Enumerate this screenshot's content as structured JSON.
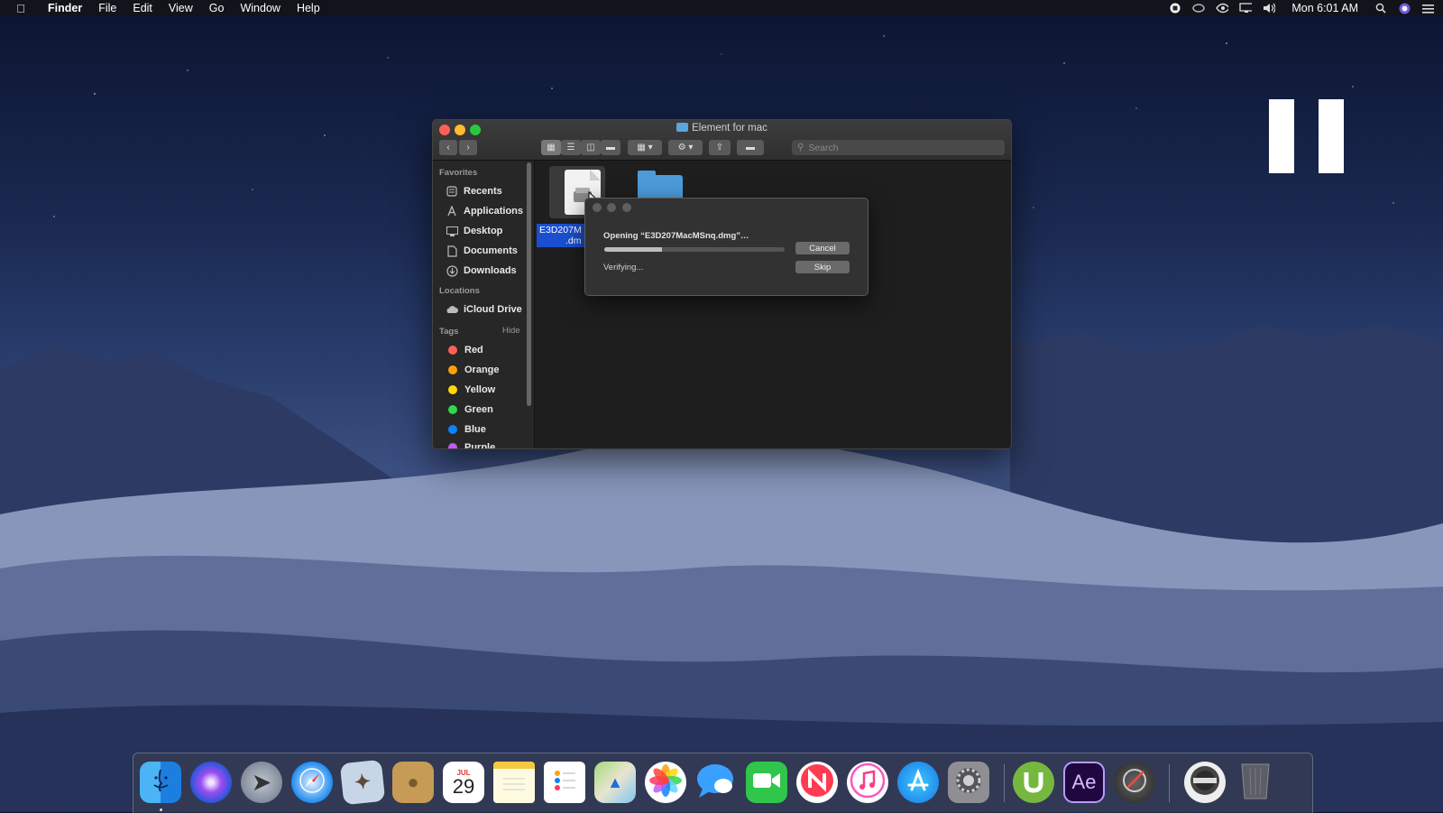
{
  "menubar": {
    "apple_icon": "apple-logo-icon",
    "items": [
      "Finder",
      "File",
      "Edit",
      "View",
      "Go",
      "Window",
      "Help"
    ],
    "clock": "Mon 6:01 AM",
    "status_icons": [
      "record-icon",
      "creative-cloud-icon",
      "nvidia-icon",
      "display-icon",
      "volume-icon",
      "search-icon",
      "siri-icon",
      "notification-center-icon"
    ]
  },
  "window": {
    "title": "Element for mac",
    "search_placeholder": "Search",
    "sidebar": {
      "favorites_label": "Favorites",
      "favorites": [
        {
          "label": "Recents",
          "icon": "clock-icon"
        },
        {
          "label": "Applications",
          "icon": "applications-icon"
        },
        {
          "label": "Desktop",
          "icon": "desktop-icon"
        },
        {
          "label": "Documents",
          "icon": "document-icon"
        },
        {
          "label": "Downloads",
          "icon": "download-icon"
        }
      ],
      "locations_label": "Locations",
      "locations": [
        {
          "label": "iCloud Drive",
          "icon": "cloud-icon"
        }
      ],
      "tags_label": "Tags",
      "tags_hide": "Hide",
      "tags": [
        {
          "label": "Red",
          "color": "#ff5f57"
        },
        {
          "label": "Orange",
          "color": "#ff9f0a"
        },
        {
          "label": "Yellow",
          "color": "#ffd60a"
        },
        {
          "label": "Green",
          "color": "#32d74b"
        },
        {
          "label": "Blue",
          "color": "#0a84ff"
        },
        {
          "label": "Purple",
          "color": "#bf5af2"
        }
      ]
    },
    "files": [
      {
        "label_line1": "E3D207M",
        "label_line2": ".dm",
        "icon": "dmg-disk-image-icon"
      },
      {
        "label": "",
        "icon": "folder-icon"
      }
    ]
  },
  "dialog": {
    "title": "Opening “E3D207MacMSnq.dmg”…",
    "status": "Verifying...",
    "progress": 0.32,
    "cancel_label": "Cancel",
    "skip_label": "Skip"
  },
  "dock": {
    "calendar_month": "JUL",
    "calendar_day": "29",
    "ae_label": "Ae",
    "apps": [
      "finder",
      "siri",
      "launchpad",
      "safari",
      "mail",
      "contacts",
      "calendar",
      "notes",
      "reminders",
      "maps",
      "photos",
      "messages",
      "facetime",
      "news",
      "itunes",
      "app-store",
      "system-preferences",
      "utorrent",
      "after-effects",
      "disk-utility",
      "webroot",
      "trash"
    ]
  },
  "colors": {
    "accent": "#1a4fd0",
    "folder": "#4d9bd8",
    "close": "#ff5f57",
    "minimize": "#febc2e",
    "zoom": "#28c840"
  }
}
